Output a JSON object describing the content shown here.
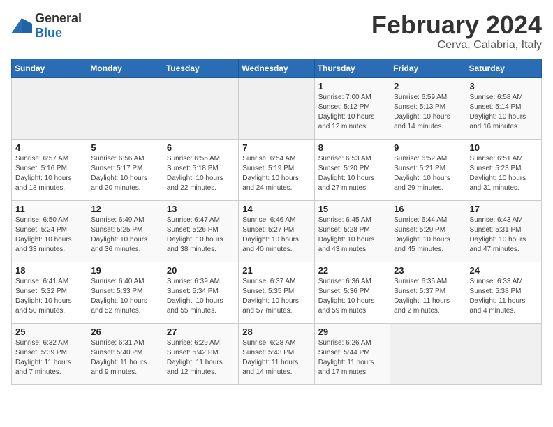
{
  "logo": {
    "general": "General",
    "blue": "Blue"
  },
  "header": {
    "month": "February 2024",
    "location": "Cerva, Calabria, Italy"
  },
  "days_of_week": [
    "Sunday",
    "Monday",
    "Tuesday",
    "Wednesday",
    "Thursday",
    "Friday",
    "Saturday"
  ],
  "weeks": [
    {
      "cells": [
        {
          "empty": true
        },
        {
          "empty": true
        },
        {
          "empty": true
        },
        {
          "empty": true
        },
        {
          "day": 1,
          "sunrise": "7:00 AM",
          "sunset": "5:12 PM",
          "daylight": "10 hours and 12 minutes."
        },
        {
          "day": 2,
          "sunrise": "6:59 AM",
          "sunset": "5:13 PM",
          "daylight": "10 hours and 14 minutes."
        },
        {
          "day": 3,
          "sunrise": "6:58 AM",
          "sunset": "5:14 PM",
          "daylight": "10 hours and 16 minutes."
        }
      ]
    },
    {
      "cells": [
        {
          "day": 4,
          "sunrise": "6:57 AM",
          "sunset": "5:16 PM",
          "daylight": "10 hours and 18 minutes."
        },
        {
          "day": 5,
          "sunrise": "6:56 AM",
          "sunset": "5:17 PM",
          "daylight": "10 hours and 20 minutes."
        },
        {
          "day": 6,
          "sunrise": "6:55 AM",
          "sunset": "5:18 PM",
          "daylight": "10 hours and 22 minutes."
        },
        {
          "day": 7,
          "sunrise": "6:54 AM",
          "sunset": "5:19 PM",
          "daylight": "10 hours and 24 minutes."
        },
        {
          "day": 8,
          "sunrise": "6:53 AM",
          "sunset": "5:20 PM",
          "daylight": "10 hours and 27 minutes."
        },
        {
          "day": 9,
          "sunrise": "6:52 AM",
          "sunset": "5:21 PM",
          "daylight": "10 hours and 29 minutes."
        },
        {
          "day": 10,
          "sunrise": "6:51 AM",
          "sunset": "5:23 PM",
          "daylight": "10 hours and 31 minutes."
        }
      ]
    },
    {
      "cells": [
        {
          "day": 11,
          "sunrise": "6:50 AM",
          "sunset": "5:24 PM",
          "daylight": "10 hours and 33 minutes."
        },
        {
          "day": 12,
          "sunrise": "6:49 AM",
          "sunset": "5:25 PM",
          "daylight": "10 hours and 36 minutes."
        },
        {
          "day": 13,
          "sunrise": "6:47 AM",
          "sunset": "5:26 PM",
          "daylight": "10 hours and 38 minutes."
        },
        {
          "day": 14,
          "sunrise": "6:46 AM",
          "sunset": "5:27 PM",
          "daylight": "10 hours and 40 minutes."
        },
        {
          "day": 15,
          "sunrise": "6:45 AM",
          "sunset": "5:28 PM",
          "daylight": "10 hours and 43 minutes."
        },
        {
          "day": 16,
          "sunrise": "6:44 AM",
          "sunset": "5:29 PM",
          "daylight": "10 hours and 45 minutes."
        },
        {
          "day": 17,
          "sunrise": "6:43 AM",
          "sunset": "5:31 PM",
          "daylight": "10 hours and 47 minutes."
        }
      ]
    },
    {
      "cells": [
        {
          "day": 18,
          "sunrise": "6:41 AM",
          "sunset": "5:32 PM",
          "daylight": "10 hours and 50 minutes."
        },
        {
          "day": 19,
          "sunrise": "6:40 AM",
          "sunset": "5:33 PM",
          "daylight": "10 hours and 52 minutes."
        },
        {
          "day": 20,
          "sunrise": "6:39 AM",
          "sunset": "5:34 PM",
          "daylight": "10 hours and 55 minutes."
        },
        {
          "day": 21,
          "sunrise": "6:37 AM",
          "sunset": "5:35 PM",
          "daylight": "10 hours and 57 minutes."
        },
        {
          "day": 22,
          "sunrise": "6:36 AM",
          "sunset": "5:36 PM",
          "daylight": "10 hours and 59 minutes."
        },
        {
          "day": 23,
          "sunrise": "6:35 AM",
          "sunset": "5:37 PM",
          "daylight": "11 hours and 2 minutes."
        },
        {
          "day": 24,
          "sunrise": "6:33 AM",
          "sunset": "5:38 PM",
          "daylight": "11 hours and 4 minutes."
        }
      ]
    },
    {
      "cells": [
        {
          "day": 25,
          "sunrise": "6:32 AM",
          "sunset": "5:39 PM",
          "daylight": "11 hours and 7 minutes."
        },
        {
          "day": 26,
          "sunrise": "6:31 AM",
          "sunset": "5:40 PM",
          "daylight": "11 hours and 9 minutes."
        },
        {
          "day": 27,
          "sunrise": "6:29 AM",
          "sunset": "5:42 PM",
          "daylight": "11 hours and 12 minutes."
        },
        {
          "day": 28,
          "sunrise": "6:28 AM",
          "sunset": "5:43 PM",
          "daylight": "11 hours and 14 minutes."
        },
        {
          "day": 29,
          "sunrise": "6:26 AM",
          "sunset": "5:44 PM",
          "daylight": "11 hours and 17 minutes."
        },
        {
          "empty": true
        },
        {
          "empty": true
        }
      ]
    }
  ]
}
